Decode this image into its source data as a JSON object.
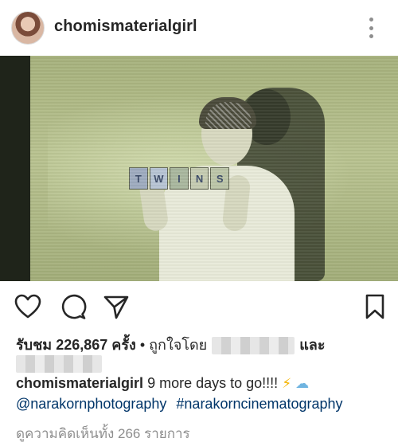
{
  "post": {
    "username": "chomismaterialgirl",
    "avatar_icon": "profile-photo-woman",
    "more_icon": "vertical-ellipsis-icon"
  },
  "photo": {
    "block_letters": [
      "T",
      "W",
      "I",
      "N",
      "S"
    ]
  },
  "actions": {
    "icons": [
      "heart-icon",
      "comment-icon",
      "share-icon",
      "bookmark-icon"
    ]
  },
  "likes": {
    "views_label": "รับชม",
    "views_count": "226,867",
    "times_label": "ครั้ง",
    "separator": "•",
    "liked_by_label": "ถูกใจโดย",
    "and_label": "และ"
  },
  "caption": {
    "username": "chomismaterialgirl",
    "text": "9 more days to go!!!!",
    "emojis": [
      "⚡",
      "☁"
    ],
    "mentions": [
      "@narakornphotography",
      "#narakorncinematography"
    ]
  },
  "comments": {
    "view_all_label": "ดูความคิดเห็นทั้ง 266 รายการ"
  },
  "colors": {
    "text": "#262626",
    "link": "#003569",
    "muted": "#8e8e8e"
  }
}
